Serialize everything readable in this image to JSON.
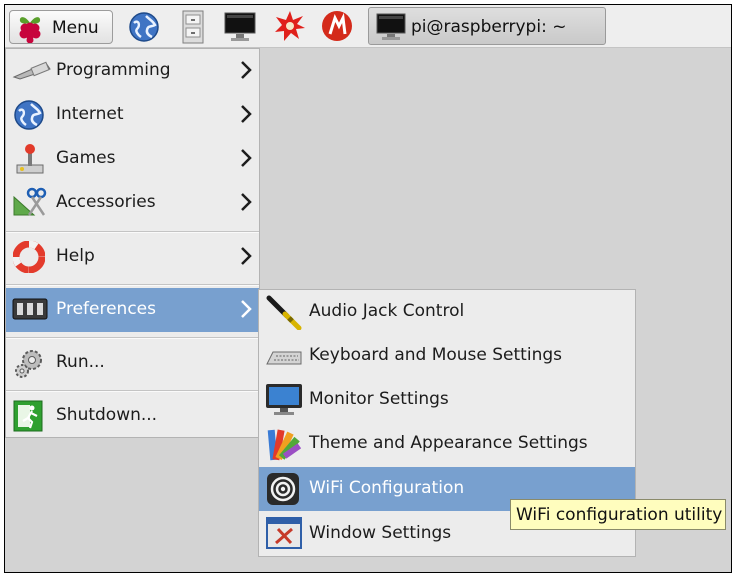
{
  "taskbar": {
    "menu_label": "Menu",
    "launchers": [
      "web-browser-icon",
      "file-manager-icon",
      "terminal-icon",
      "wolfram-icon",
      "mathematica-icon"
    ],
    "task_title": "pi@raspberrypi: ~"
  },
  "main_menu": {
    "items": [
      {
        "label": "Programming",
        "icon": "programming-icon",
        "has_submenu": true
      },
      {
        "label": "Internet",
        "icon": "globe-icon",
        "has_submenu": true
      },
      {
        "label": "Games",
        "icon": "joystick-icon",
        "has_submenu": true
      },
      {
        "label": "Accessories",
        "icon": "accessories-icon",
        "has_submenu": true
      },
      {
        "label": "Help",
        "icon": "lifebuoy-icon",
        "has_submenu": true
      },
      {
        "label": "Preferences",
        "icon": "preferences-icon",
        "has_submenu": true,
        "selected": true
      },
      {
        "label": "Run...",
        "icon": "gears-icon",
        "has_submenu": false
      },
      {
        "label": "Shutdown...",
        "icon": "exit-icon",
        "has_submenu": false
      }
    ]
  },
  "preferences_menu": {
    "items": [
      {
        "label": "Audio Jack Control",
        "icon": "audio-jack-icon"
      },
      {
        "label": "Keyboard and Mouse Settings",
        "icon": "keyboard-icon"
      },
      {
        "label": "Monitor Settings",
        "icon": "monitor-icon"
      },
      {
        "label": "Theme and Appearance Settings",
        "icon": "theme-palette-icon"
      },
      {
        "label": "WiFi Configuration",
        "icon": "wifi-icon",
        "selected": true
      },
      {
        "label": "Window Settings",
        "icon": "window-settings-icon"
      }
    ]
  },
  "tooltip": {
    "text": "WiFi configuration utility"
  },
  "colors": {
    "selection": "#78a0cf",
    "menu_bg": "#ececec",
    "desktop_bg": "#d3d3d3",
    "tooltip_bg": "#fffdbe"
  }
}
